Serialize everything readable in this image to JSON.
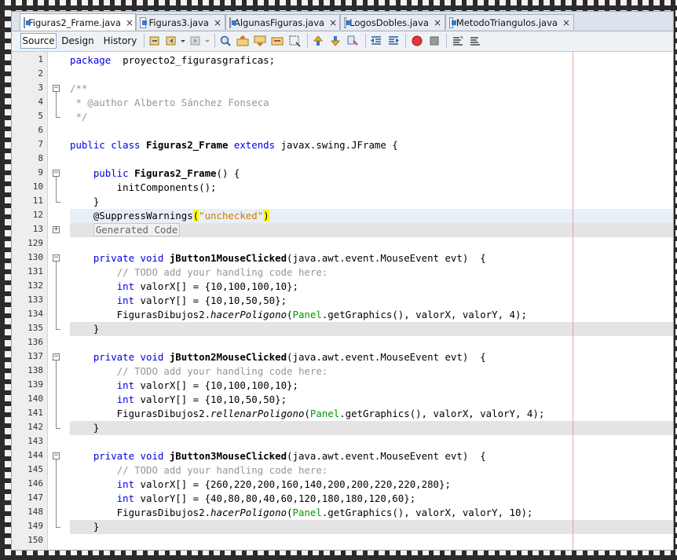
{
  "tabs": [
    {
      "label": "Figuras2_Frame.java",
      "active": true
    },
    {
      "label": "Figuras3.java",
      "active": false
    },
    {
      "label": "AlgunasFiguras.java",
      "active": false
    },
    {
      "label": "LogosDobles.java",
      "active": false
    },
    {
      "label": "MetodoTriangulos.java",
      "active": false
    }
  ],
  "close_glyph": "×",
  "views": {
    "source": "Source",
    "design": "Design",
    "history": "History"
  },
  "toolbar_icons": [
    "last-edit-icon",
    "back-icon",
    "forward-icon",
    "find-icon",
    "find-previous-icon",
    "find-next-icon",
    "toggle-highlight-icon",
    "find-selection-icon",
    "previous-bookmark-icon",
    "next-bookmark-icon",
    "toggle-bookmark-icon",
    "shift-left-icon",
    "shift-right-icon",
    "start-macro-icon",
    "stop-macro-icon",
    "comment-icon",
    "uncomment-icon"
  ],
  "colors": {
    "keyword": "#0000e6",
    "comment": "#969696",
    "string": "#ce7b00",
    "field": "#009900"
  },
  "lines": [
    {
      "n": "1",
      "tokens": [
        [
          "kw",
          "package"
        ],
        [
          "",
          "  proyecto2_figurasgraficas;"
        ]
      ]
    },
    {
      "n": "2",
      "tokens": []
    },
    {
      "n": "3",
      "tokens": [
        [
          "cm",
          "/**"
        ]
      ]
    },
    {
      "n": "4",
      "tokens": [
        [
          "cm",
          " * @author Alberto Sánchez Fonseca"
        ]
      ]
    },
    {
      "n": "5",
      "tokens": [
        [
          "cm",
          " */"
        ]
      ]
    },
    {
      "n": "6",
      "tokens": []
    },
    {
      "n": "7",
      "tokens": [
        [
          "kw",
          "public class "
        ],
        [
          "b",
          "Figuras2_Frame"
        ],
        [
          "kw",
          " extends"
        ],
        [
          "",
          " javax.swing.JFrame {"
        ]
      ]
    },
    {
      "n": "8",
      "tokens": []
    },
    {
      "n": "9",
      "tokens": [
        [
          "",
          "    "
        ],
        [
          "kw",
          "public "
        ],
        [
          "b",
          "Figuras2_Frame"
        ],
        [
          "",
          "() {"
        ]
      ]
    },
    {
      "n": "10",
      "tokens": [
        [
          "",
          "        initComponents();"
        ]
      ]
    },
    {
      "n": "11",
      "tokens": [
        [
          "",
          "    }"
        ]
      ]
    },
    {
      "n": "12",
      "tokens": [
        [
          "",
          "    @SuppressWarnings"
        ],
        [
          "hlp",
          "("
        ],
        [
          "str",
          "\"unchecked\""
        ],
        [
          "hlp",
          ")"
        ]
      ]
    },
    {
      "n": "13",
      "tokens": [
        [
          "",
          "    "
        ],
        [
          "gen",
          "Generated Code"
        ]
      ]
    },
    {
      "n": "129",
      "tokens": []
    },
    {
      "n": "130",
      "tokens": [
        [
          "",
          "    "
        ],
        [
          "kw",
          "private void "
        ],
        [
          "b",
          "jButton1MouseClicked"
        ],
        [
          "",
          "(java.awt.event.MouseEvent evt)  {"
        ]
      ]
    },
    {
      "n": "131",
      "tokens": [
        [
          "",
          "        "
        ],
        [
          "cm",
          "// TODO add your handling code here:"
        ]
      ]
    },
    {
      "n": "132",
      "tokens": [
        [
          "",
          "        "
        ],
        [
          "kw",
          "int"
        ],
        [
          "",
          " valorX[] = {10,100,100,10};"
        ]
      ]
    },
    {
      "n": "133",
      "tokens": [
        [
          "",
          "        "
        ],
        [
          "kw",
          "int"
        ],
        [
          "",
          " valorY[] = {10,10,50,50};"
        ]
      ]
    },
    {
      "n": "134",
      "tokens": [
        [
          "",
          "        FigurasDibujos2."
        ],
        [
          "it",
          "hacerPoligono"
        ],
        [
          "",
          "("
        ],
        [
          "fld",
          "Panel"
        ],
        [
          "",
          ".getGraphics(), valorX, valorY, 4);"
        ]
      ]
    },
    {
      "n": "135",
      "tokens": [
        [
          "",
          "    }"
        ]
      ]
    },
    {
      "n": "136",
      "tokens": []
    },
    {
      "n": "137",
      "tokens": [
        [
          "",
          "    "
        ],
        [
          "kw",
          "private void "
        ],
        [
          "b",
          "jButton2MouseClicked"
        ],
        [
          "",
          "(java.awt.event.MouseEvent evt)  {"
        ]
      ]
    },
    {
      "n": "138",
      "tokens": [
        [
          "",
          "        "
        ],
        [
          "cm",
          "// TODO add your handling code here:"
        ]
      ]
    },
    {
      "n": "139",
      "tokens": [
        [
          "",
          "        "
        ],
        [
          "kw",
          "int"
        ],
        [
          "",
          " valorX[] = {10,100,100,10};"
        ]
      ]
    },
    {
      "n": "140",
      "tokens": [
        [
          "",
          "        "
        ],
        [
          "kw",
          "int"
        ],
        [
          "",
          " valorY[] = {10,10,50,50};"
        ]
      ]
    },
    {
      "n": "141",
      "tokens": [
        [
          "",
          "        FigurasDibujos2."
        ],
        [
          "it",
          "rellenarPoligono"
        ],
        [
          "",
          "("
        ],
        [
          "fld",
          "Panel"
        ],
        [
          "",
          ".getGraphics(), valorX, valorY, 4);"
        ]
      ]
    },
    {
      "n": "142",
      "tokens": [
        [
          "",
          "    }"
        ]
      ]
    },
    {
      "n": "143",
      "tokens": []
    },
    {
      "n": "144",
      "tokens": [
        [
          "",
          "    "
        ],
        [
          "kw",
          "private void "
        ],
        [
          "b",
          "jButton3MouseClicked"
        ],
        [
          "",
          "(java.awt.event.MouseEvent evt)  {"
        ]
      ]
    },
    {
      "n": "145",
      "tokens": [
        [
          "",
          "        "
        ],
        [
          "cm",
          "// TODO add your handling code here:"
        ]
      ]
    },
    {
      "n": "146",
      "tokens": [
        [
          "",
          "        "
        ],
        [
          "kw",
          "int"
        ],
        [
          "",
          " valorX[] = {260,220,200,160,140,200,200,220,220,280};"
        ]
      ]
    },
    {
      "n": "147",
      "tokens": [
        [
          "",
          "        "
        ],
        [
          "kw",
          "int"
        ],
        [
          "",
          " valorY[] = {40,80,80,40,60,120,180,180,120,60};"
        ]
      ]
    },
    {
      "n": "148",
      "tokens": [
        [
          "",
          "        FigurasDibujos2."
        ],
        [
          "it",
          "hacerPoligono"
        ],
        [
          "",
          "("
        ],
        [
          "fld",
          "Panel"
        ],
        [
          "",
          ".getGraphics(), valorX, valorY, 10);"
        ]
      ]
    },
    {
      "n": "149",
      "tokens": [
        [
          "",
          "    }"
        ]
      ]
    },
    {
      "n": "150",
      "tokens": []
    }
  ]
}
